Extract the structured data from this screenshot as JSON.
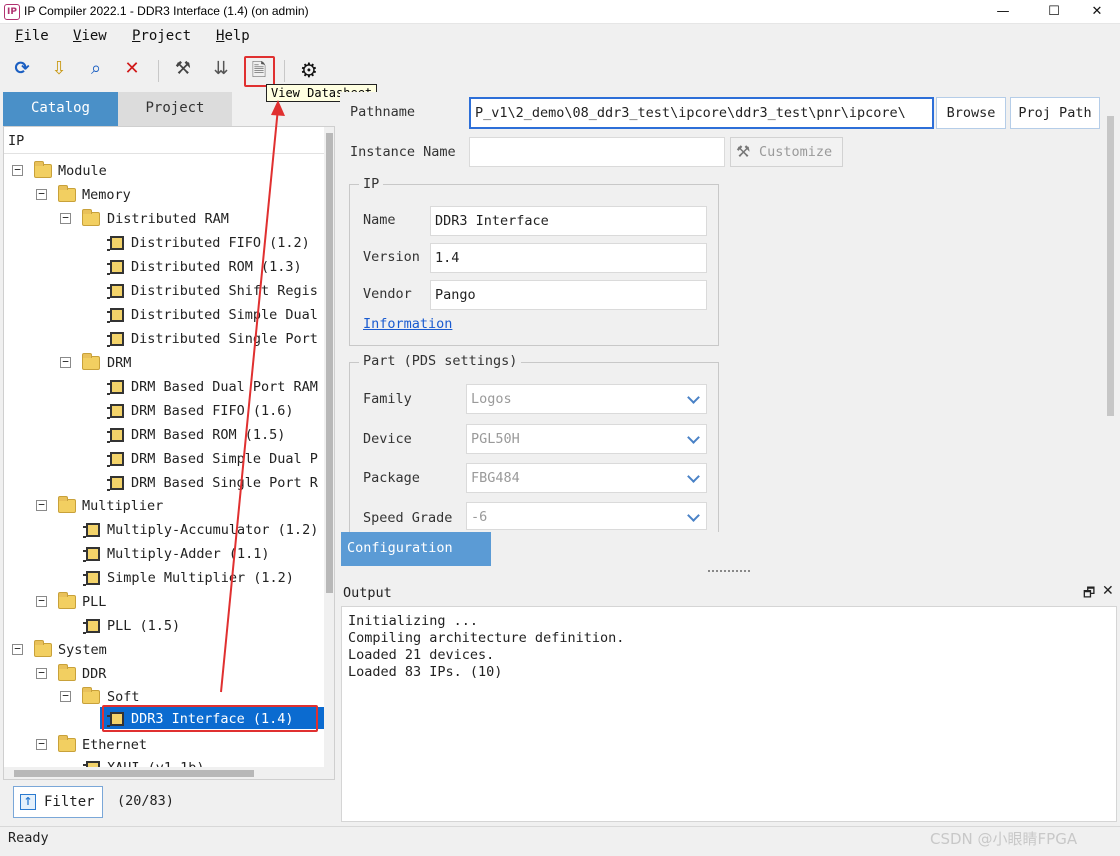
{
  "window": {
    "title": "IP Compiler 2022.1 - DDR3 Interface (1.4) (on admin)",
    "app_icon": "IP",
    "minimize": "—",
    "maximize": "☐",
    "close": "✕"
  },
  "menu": {
    "file": {
      "key": "F",
      "rest": "ile"
    },
    "view": {
      "key": "V",
      "rest": "iew"
    },
    "project": {
      "key": "P",
      "rest": "roject"
    },
    "help": {
      "key": "H",
      "rest": "elp"
    }
  },
  "toolbar": {
    "refresh": "⟳",
    "open": "⇩",
    "search": "⌕",
    "delete": "✕",
    "generate": "⚒",
    "export": "⇊",
    "datasheet": "🗎",
    "settings": "⚙",
    "tooltip": "View Datasheet"
  },
  "left_tabs": {
    "catalog": "Catalog",
    "project": "Project"
  },
  "tree": {
    "header": "IP",
    "module": "Module",
    "memory": "Memory",
    "distributed_ram": "Distributed RAM",
    "dist_items": [
      "Distributed FIFO (1.2)",
      "Distributed ROM (1.3)",
      "Distributed Shift Regis",
      "Distributed Simple Dual",
      "Distributed Single Port"
    ],
    "drm": "DRM",
    "drm_items": [
      "DRM Based Dual Port RAM",
      "DRM Based FIFO (1.6)",
      "DRM Based ROM (1.5)",
      "DRM Based Simple Dual P",
      "DRM Based Single Port R"
    ],
    "multiplier": "Multiplier",
    "mult_items": [
      "Multiply-Accumulator (1.2)",
      "Multiply-Adder (1.1)",
      "Simple Multiplier (1.2)"
    ],
    "pll": "PLL",
    "pll_item": "PLL (1.5)",
    "system": "System",
    "ddr": "DDR",
    "soft": "Soft",
    "ddr3_item": "DDR3 Interface (1.4)",
    "ethernet": "Ethernet",
    "xaui_item": "XAUI (v1.1b)"
  },
  "filter": {
    "label": "Filter",
    "count": "(20/83)"
  },
  "form": {
    "pathname_label": "Pathname",
    "pathname_value": "P_v1\\2_demo\\08_ddr3_test\\ipcore\\ddr3_test\\pnr\\ipcore\\",
    "browse": "Browse",
    "proj_path": "Proj Path",
    "instance_label": "Instance Name",
    "instance_value": "",
    "customize": "Customize",
    "ip_group": "IP",
    "name_label": "Name",
    "name_value": "DDR3 Interface",
    "version_label": "Version",
    "version_value": "1.4",
    "vendor_label": "Vendor",
    "vendor_value": "Pango",
    "information": "Information",
    "part_group": "Part (PDS settings)",
    "family_label": "Family",
    "family_value": "Logos",
    "device_label": "Device",
    "device_value": "PGL50H",
    "package_label": "Package",
    "package_value": "FBG484",
    "speed_label": "Speed Grade",
    "speed_value": "-6"
  },
  "config_tab": "Configuration",
  "output": {
    "title": "Output",
    "restore": "🗗",
    "close": "✕",
    "lines": [
      "Initializing ...",
      "Compiling architecture definition.",
      "Loaded 21 devices.",
      "Loaded 83 IPs. (10)"
    ]
  },
  "status": "Ready",
  "watermark": "CSDN @小眼睛FPGA",
  "colors": {
    "accent": "#0b6bd0",
    "annotation": "#e03030",
    "tab_active": "#4a90c8"
  }
}
